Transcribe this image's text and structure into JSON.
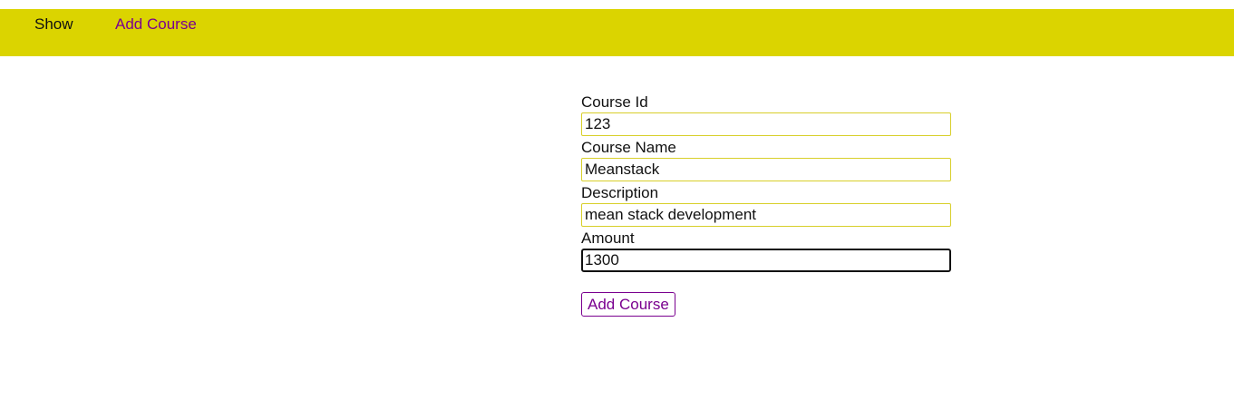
{
  "nav": {
    "items": [
      {
        "label": "Show"
      },
      {
        "label": "Add Course"
      }
    ]
  },
  "form": {
    "fields": [
      {
        "label": "Course Id",
        "value": "123"
      },
      {
        "label": "Course Name",
        "value": "Meanstack"
      },
      {
        "label": "Description",
        "value": "mean stack development"
      },
      {
        "label": "Amount",
        "value": "1300"
      }
    ],
    "submit_label": "Add Course"
  },
  "colors": {
    "navbar_bg": "#dbd400",
    "link": "#7a008f",
    "input_border": "#d8cf2a"
  }
}
